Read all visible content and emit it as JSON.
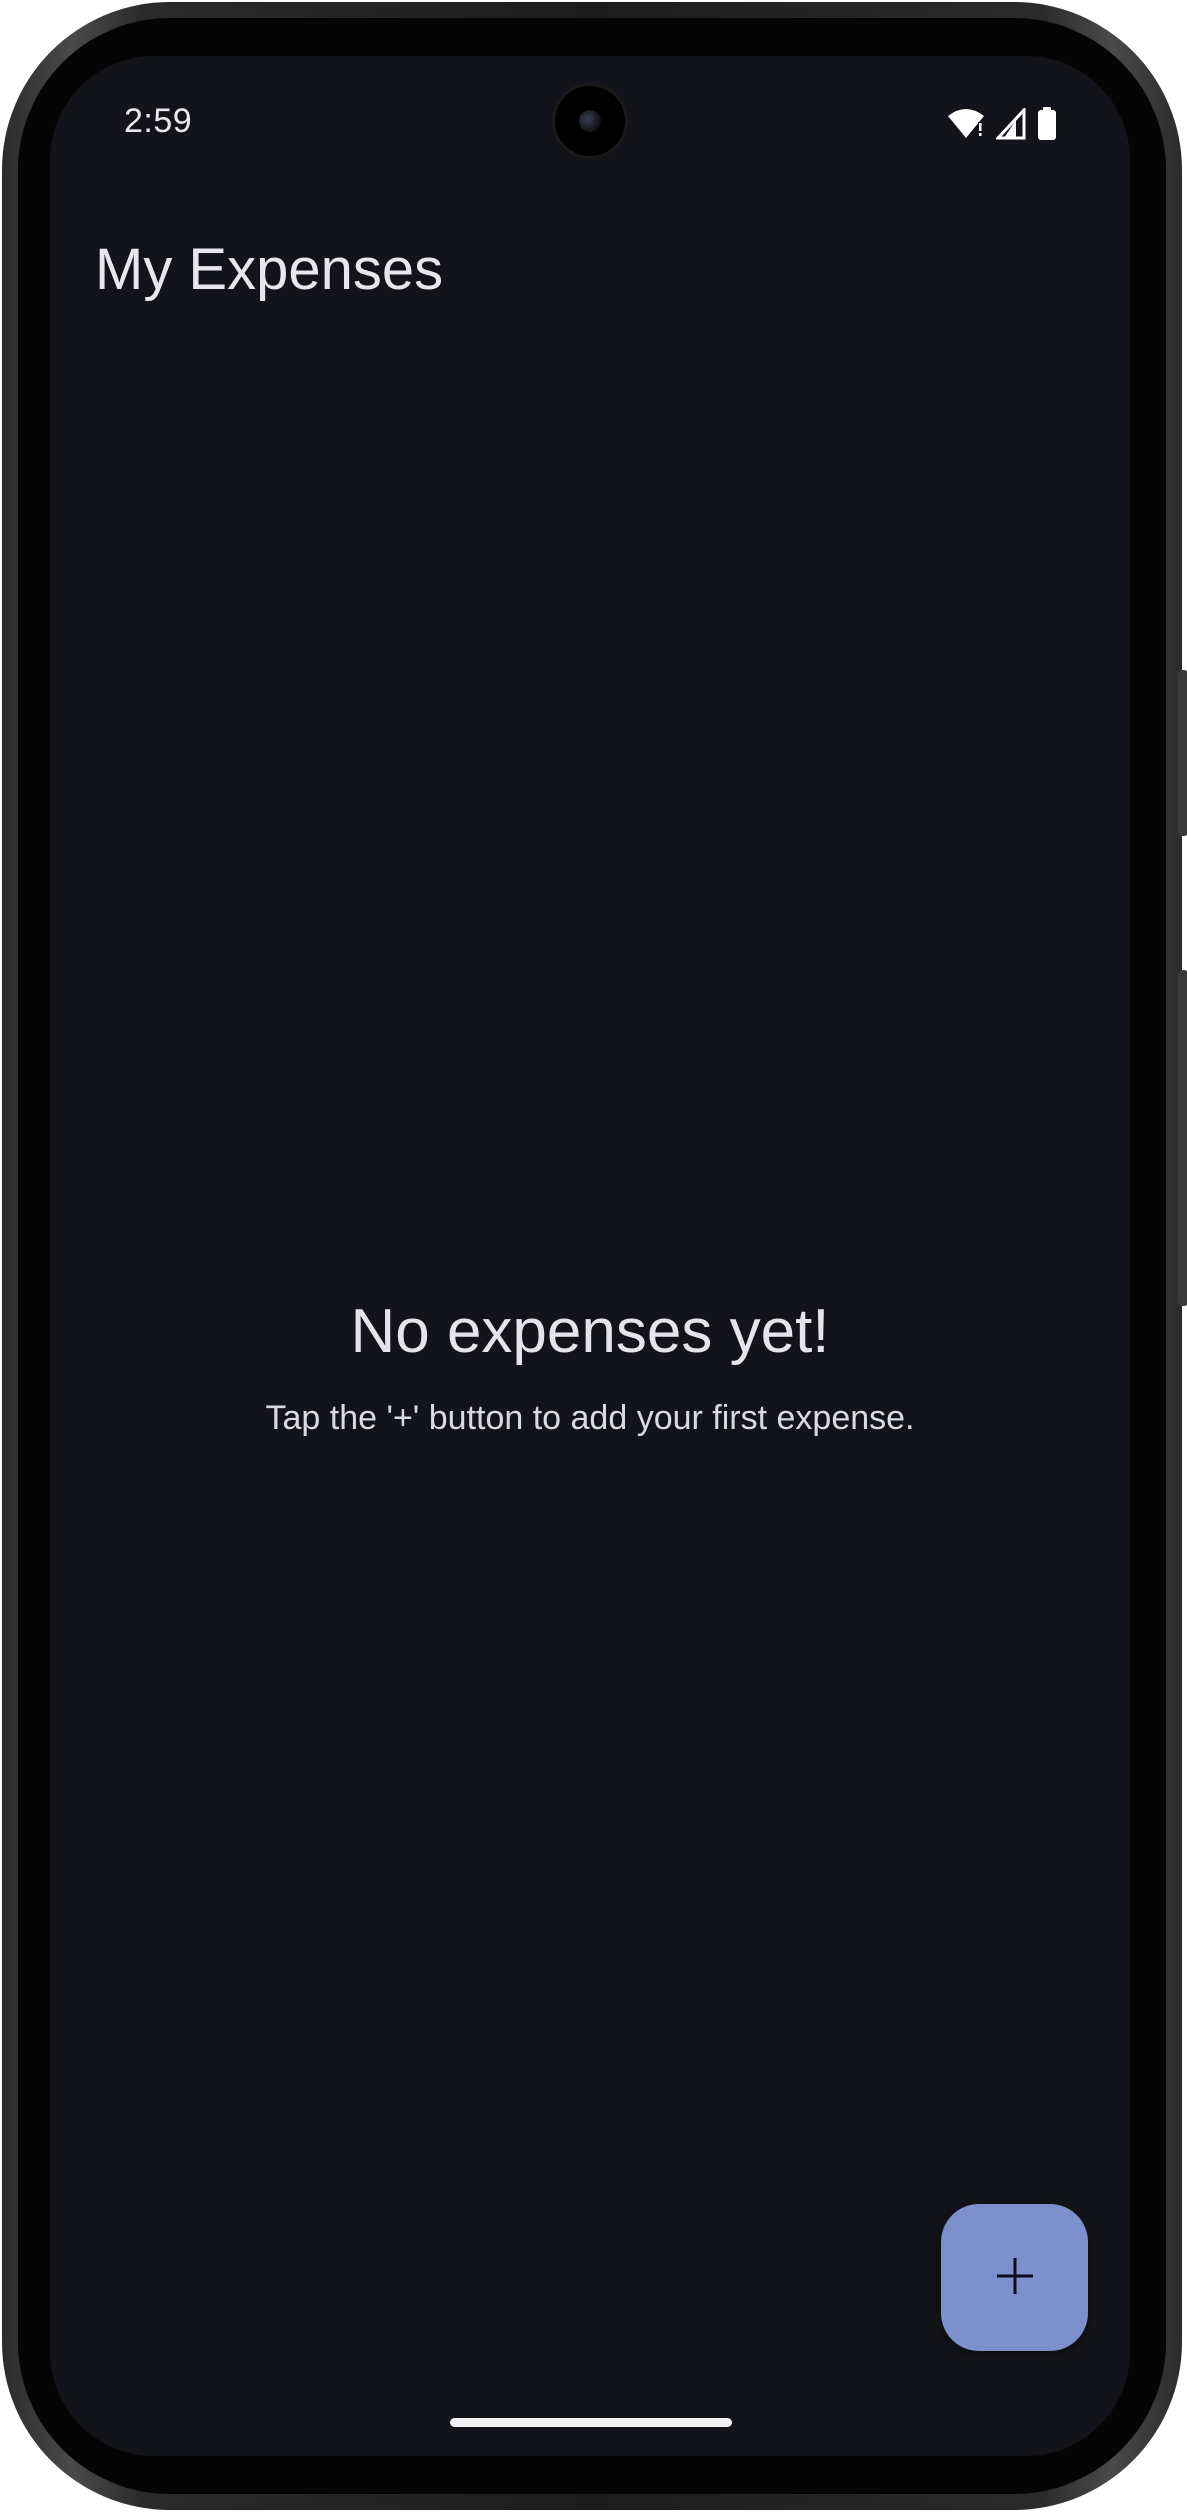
{
  "status_bar": {
    "time": "2:59",
    "icons": [
      "wifi-alert-icon",
      "cell-signal-icon",
      "battery-icon"
    ]
  },
  "app_bar": {
    "title": "My Expenses"
  },
  "empty_state": {
    "title": "No expenses yet!",
    "subtitle": "Tap the '+' button to add your first expense."
  },
  "fab": {
    "icon": "plus-icon"
  },
  "colors": {
    "background": "#131419",
    "fab": "#7b90cc",
    "text_primary": "#e6e6ec"
  }
}
